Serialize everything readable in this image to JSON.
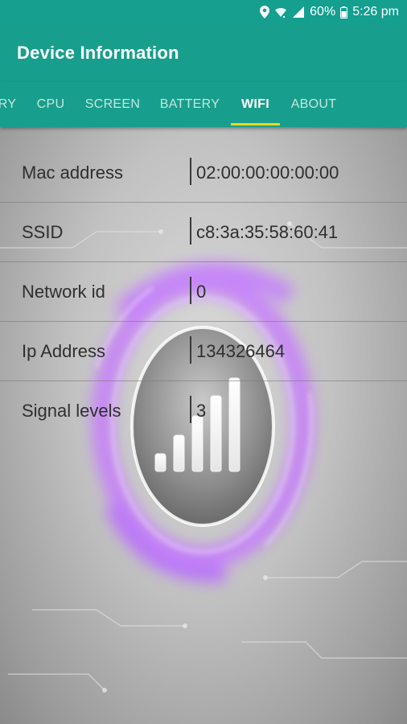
{
  "status_bar": {
    "battery": "60%",
    "time": "5:26 pm",
    "icons": [
      "location-icon",
      "wifi-icon",
      "signal-icon",
      "battery-icon"
    ]
  },
  "app_bar": {
    "title": "Device Information"
  },
  "tabs": [
    {
      "label": "RY",
      "active": false
    },
    {
      "label": "CPU",
      "active": false
    },
    {
      "label": "SCREEN",
      "active": false
    },
    {
      "label": "BATTERY",
      "active": false
    },
    {
      "label": "WIFI",
      "active": true
    },
    {
      "label": "ABOUT",
      "active": false
    }
  ],
  "wifi_info": {
    "rows": [
      {
        "label": "Mac address",
        "value": "02:00:00:00:00:00"
      },
      {
        "label": "SSID",
        "value": "c8:3a:35:58:60:41"
      },
      {
        "label": "Network id",
        "value": "0"
      },
      {
        "label": "Ip Address",
        "value": "134326464"
      },
      {
        "label": "Signal levels",
        "value": "3"
      }
    ]
  },
  "colors": {
    "primary": "#189e8c",
    "status_bar": "#149f8f",
    "tab_indicator": "#f2d31b",
    "glow": "#c77dff"
  }
}
